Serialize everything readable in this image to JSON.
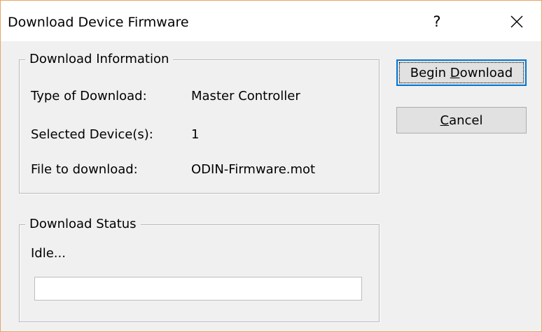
{
  "window": {
    "title": "Download Device Firmware",
    "help_label": "?"
  },
  "info_group": {
    "legend": "Download Information",
    "rows": [
      {
        "label": "Type of Download:",
        "value": "Master Controller"
      },
      {
        "label": "Selected Device(s):",
        "value": "1"
      },
      {
        "label": "File to download:",
        "value": "ODIN-Firmware.mot"
      }
    ]
  },
  "status_group": {
    "legend": "Download Status",
    "status_text": "Idle...",
    "progress": 0
  },
  "buttons": {
    "begin_pre": "Begin ",
    "begin_mnemonic": "D",
    "begin_post": "ownload",
    "cancel_mnemonic": "C",
    "cancel_post": "ancel"
  },
  "colors": {
    "window_border": "#e8a26a",
    "dialog_bg": "#f0f0f0",
    "focus_border": "#0078d7"
  },
  "icons": {
    "close": "close-icon"
  }
}
